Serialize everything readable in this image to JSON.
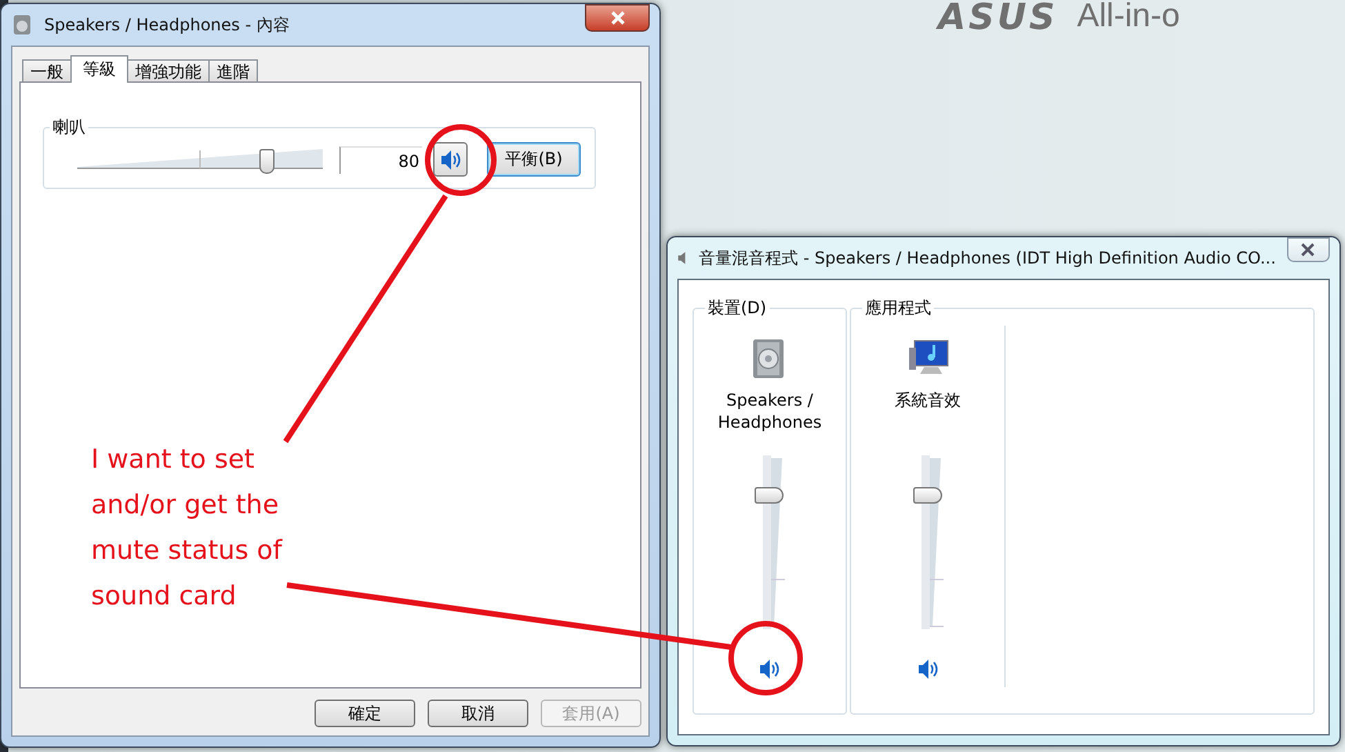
{
  "desktop": {
    "logo": "ASUS",
    "tagline": "All-in-o"
  },
  "properties_window": {
    "title": "Speakers / Headphones - 內容",
    "tabs": [
      {
        "label": "一般",
        "selected": false
      },
      {
        "label": "等級",
        "selected": true
      },
      {
        "label": "增強功能",
        "selected": false
      },
      {
        "label": "進階",
        "selected": false
      }
    ],
    "level_group": {
      "label": "喇叭",
      "level": 0.79,
      "value": "80",
      "muted": false,
      "balance_button": "平衡(B)"
    },
    "buttons": [
      {
        "label": "確定",
        "disabled": false
      },
      {
        "label": "取消",
        "disabled": false
      },
      {
        "label": "套用(A)",
        "disabled": true
      }
    ]
  },
  "mixer_window": {
    "title": "音量混音程式 - Speakers / Headphones (IDT High Definition Audio CO...",
    "device_group": {
      "label": "裝置(D)",
      "channels": [
        {
          "kind": "speaker",
          "name": "Speakers / Headphones",
          "level": 0.8,
          "muted": false
        }
      ]
    },
    "app_group": {
      "label": "應用程式",
      "channels": [
        {
          "kind": "monitor",
          "name": "系統音效",
          "level": 0.8,
          "muted": false
        }
      ]
    }
  },
  "annotation": {
    "note": "I want to set and/or get the mute status of sound card"
  }
}
